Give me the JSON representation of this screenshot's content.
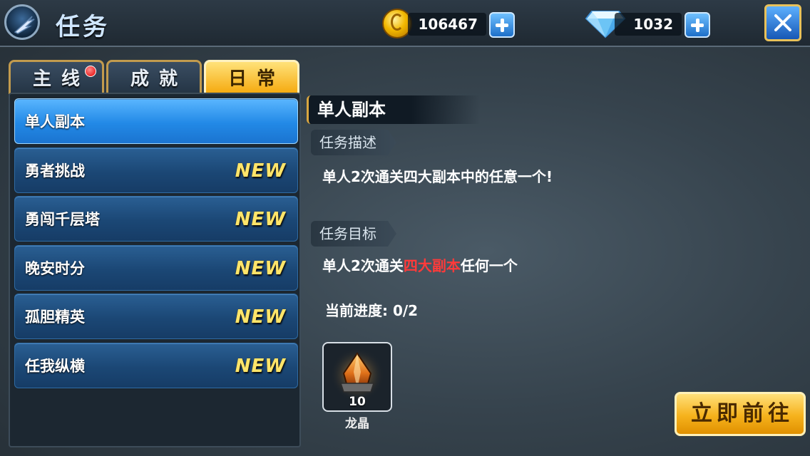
{
  "header": {
    "title": "任务",
    "gold": "106467",
    "diamonds": "1032"
  },
  "tabs": [
    {
      "label": "主线",
      "active": false,
      "has_notification": true
    },
    {
      "label": "成就",
      "active": false,
      "has_notification": false
    },
    {
      "label": "日常",
      "active": true,
      "has_notification": false
    }
  ],
  "task_list": [
    {
      "label": "单人副本",
      "selected": true,
      "badge": ""
    },
    {
      "label": "勇者挑战",
      "selected": false,
      "badge": "NEW"
    },
    {
      "label": "勇闯千层塔",
      "selected": false,
      "badge": "NEW"
    },
    {
      "label": "晚安时分",
      "selected": false,
      "badge": "NEW"
    },
    {
      "label": "孤胆精英",
      "selected": false,
      "badge": "NEW"
    },
    {
      "label": "任我纵横",
      "selected": false,
      "badge": "NEW"
    }
  ],
  "detail": {
    "title": "单人副本",
    "description_label": "任务描述",
    "description": "单人2次通关四大副本中的任意一个!",
    "goal_label": "任务目标",
    "goal_prefix": "单人2次通关",
    "goal_highlight": "四大副本",
    "goal_suffix": "任何一个",
    "progress": "当前进度: 0/2",
    "reward": {
      "icon": "dragon-crystal-icon",
      "count": "10",
      "name": "龙晶"
    },
    "go_button": "立即前往"
  },
  "colors": {
    "accent_gold": "#f6b21c",
    "selected_blue": "#2289e6",
    "highlight_red": "#ff3a3a",
    "new_badge_yellow": "#ffe56a"
  }
}
